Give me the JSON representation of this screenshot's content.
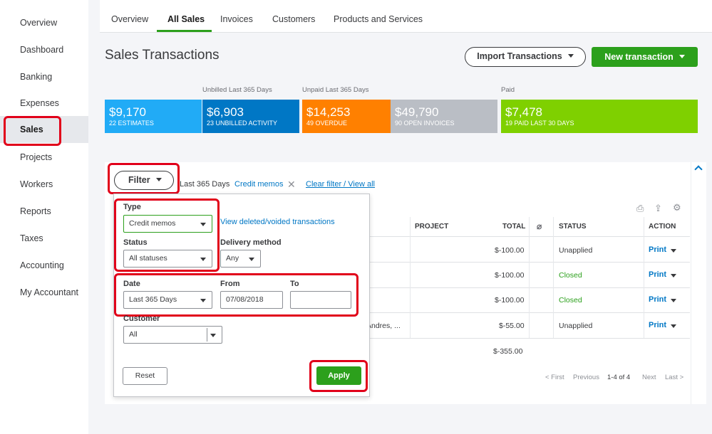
{
  "sidebar": {
    "items": [
      {
        "label": "Overview"
      },
      {
        "label": "Dashboard"
      },
      {
        "label": "Banking"
      },
      {
        "label": "Expenses"
      },
      {
        "label": "Sales"
      },
      {
        "label": "Projects"
      },
      {
        "label": "Workers"
      },
      {
        "label": "Reports"
      },
      {
        "label": "Taxes"
      },
      {
        "label": "Accounting"
      },
      {
        "label": "My Accountant"
      }
    ],
    "active": "Sales"
  },
  "tabs": [
    {
      "label": "Overview"
    },
    {
      "label": "All Sales"
    },
    {
      "label": "Invoices"
    },
    {
      "label": "Customers"
    },
    {
      "label": "Products and Services"
    }
  ],
  "header": {
    "title": "Sales Transactions",
    "import_label": "Import Transactions",
    "new_label": "New transaction"
  },
  "money_bar": {
    "unbilled_caption": "Unbilled Last 365 Days",
    "unpaid_caption": "Unpaid Last 365 Days",
    "paid_caption": "Paid",
    "blocks": [
      {
        "amount": "$9,170",
        "sub": "22 ESTIMATES",
        "color": "#21abf6"
      },
      {
        "amount": "$6,903",
        "sub": "23 UNBILLED ACTIVITY",
        "color": "#0077c5"
      },
      {
        "amount": "$14,253",
        "sub": "49 OVERDUE",
        "color": "#ff8000"
      },
      {
        "amount": "$49,790",
        "sub": "90 OPEN INVOICES",
        "color": "#babec5"
      },
      {
        "amount": "$7,478",
        "sub": "19 PAID LAST 30 DAYS",
        "color": "#7fd000"
      }
    ]
  },
  "filter_bar": {
    "button_label": "Filter",
    "chip_date": "Last 365 Days",
    "chip_type": "Credit memos",
    "clear_link": "Clear filter / View all"
  },
  "filter_panel": {
    "type_label": "Type",
    "type_value": "Credit memos",
    "deleted_link": "View deleted/voided transactions",
    "status_label": "Status",
    "status_value": "All statuses",
    "delivery_label": "Delivery method",
    "delivery_value": "Any",
    "date_label": "Date",
    "date_value": "Last 365 Days",
    "from_label": "From",
    "from_value": "07/08/2018",
    "to_label": "To",
    "to_value": "",
    "customer_label": "Customer",
    "customer_value": "All",
    "reset_label": "Reset",
    "apply_label": "Apply"
  },
  "table": {
    "headers": {
      "project": "PROJECT",
      "total": "TOTAL",
      "status": "STATUS",
      "action": "ACTION"
    },
    "rows": [
      {
        "customer": "",
        "total": "$-100.00",
        "status": "Unapplied",
        "action": "Print"
      },
      {
        "customer": "",
        "total": "$-100.00",
        "status": "Closed",
        "action": "Print"
      },
      {
        "customer": "",
        "total": "$-100.00",
        "status": "Closed",
        "action": "Print"
      },
      {
        "customer": "Andres, ...",
        "total": "$-55.00",
        "status": "Unapplied",
        "action": "Print"
      }
    ],
    "grand_total": "$-355.00"
  },
  "pager": {
    "first": "< First",
    "previous": "Previous",
    "range": "1-4 of 4",
    "next": "Next",
    "last": "Last >"
  }
}
